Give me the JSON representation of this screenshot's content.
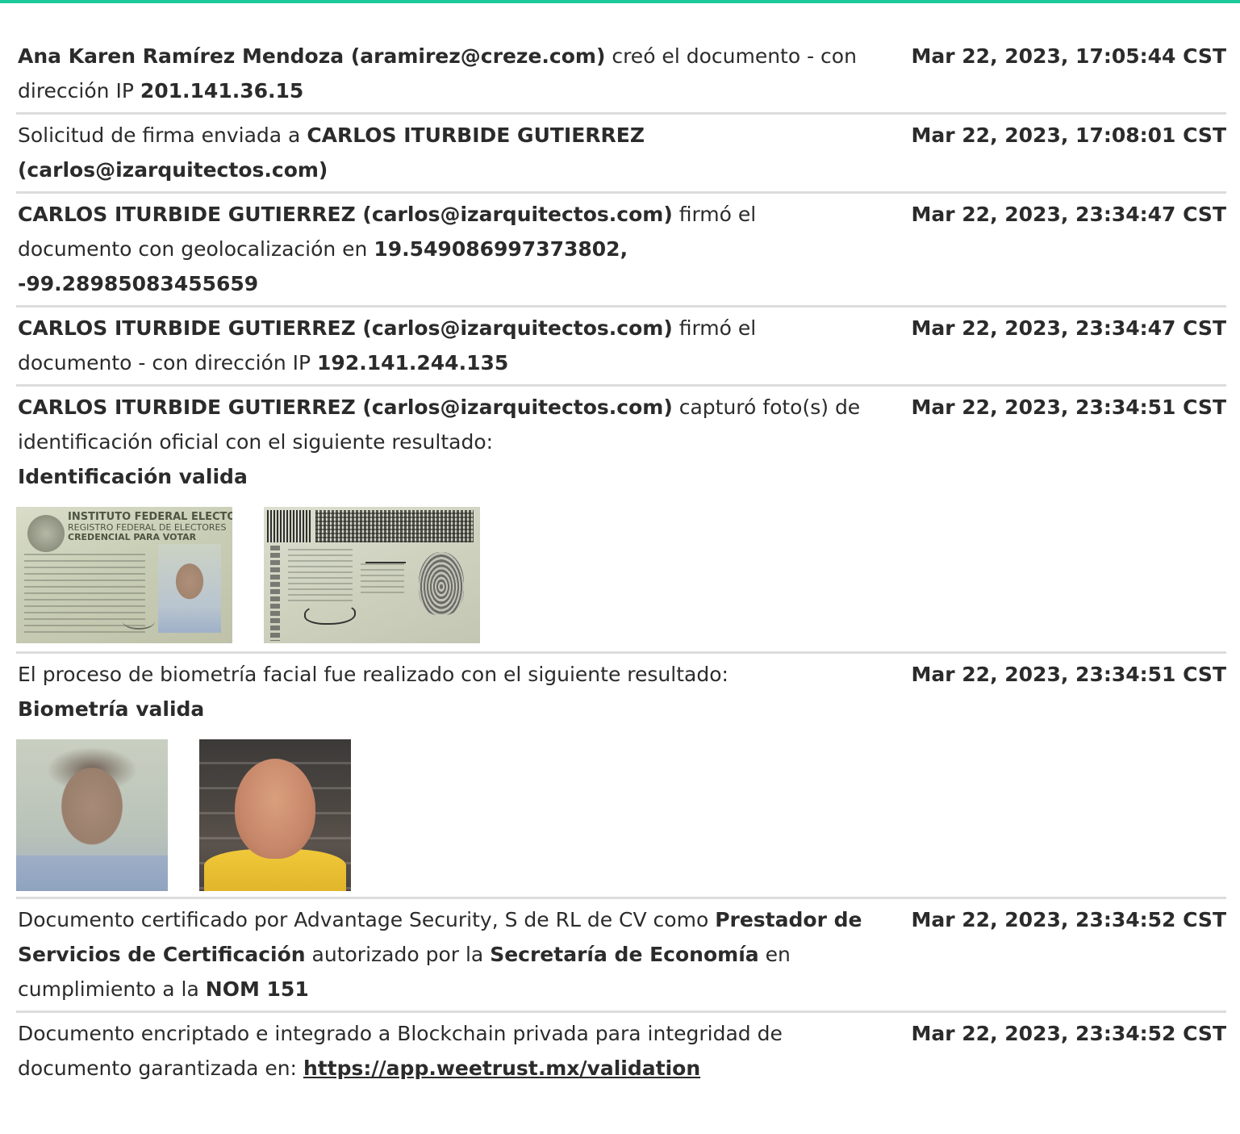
{
  "accent_color": "#1cc99b",
  "entries": [
    {
      "parts": [
        {
          "t": "Ana Karen Ramírez Mendoza (aramirez@creze.com)",
          "b": true
        },
        {
          "t": " creó el documento - con dirección IP ",
          "b": false
        },
        {
          "t": "201.141.36.15",
          "b": true
        }
      ],
      "timestamp": "Mar 22, 2023, 17:05:44 CST"
    },
    {
      "parts": [
        {
          "t": "Solicitud de firma enviada a ",
          "b": false
        },
        {
          "t": "CARLOS ITURBIDE GUTIERREZ (carlos@izarquitectos.com)",
          "b": true
        }
      ],
      "timestamp": "Mar 22, 2023, 17:08:01 CST"
    },
    {
      "parts": [
        {
          "t": "CARLOS ITURBIDE GUTIERREZ (carlos@izarquitectos.com)",
          "b": true
        },
        {
          "t": " firmó el documento con geolocalización en ",
          "b": false
        },
        {
          "t": "19.549086997373802, -99.28985083455659",
          "b": true
        }
      ],
      "timestamp": "Mar 22, 2023, 23:34:47 CST"
    },
    {
      "parts": [
        {
          "t": "CARLOS ITURBIDE GUTIERREZ (carlos@izarquitectos.com)",
          "b": true
        },
        {
          "t": " firmó el documento - con dirección IP ",
          "b": false
        },
        {
          "t": "192.141.244.135",
          "b": true
        }
      ],
      "timestamp": "Mar 22, 2023, 23:34:47 CST"
    },
    {
      "parts": [
        {
          "t": "CARLOS ITURBIDE GUTIERREZ (carlos@izarquitectos.com)",
          "b": true
        },
        {
          "t": " capturó foto(s) de identificación oficial con el siguiente resultado:",
          "b": false
        }
      ],
      "result": "Identificación valida",
      "timestamp": "Mar 22, 2023, 23:34:51 CST",
      "images": [
        {
          "name": "ine-front-photo",
          "lines": [
            "INSTITUTO FEDERAL ELECTORAL",
            "REGISTRO FEDERAL DE ELECTORES",
            "CREDENCIAL PARA VOTAR"
          ]
        },
        {
          "name": "ine-back-photo"
        }
      ]
    },
    {
      "parts": [
        {
          "t": "El proceso de biometría facial fue realizado con el siguiente resultado:",
          "b": false
        }
      ],
      "result": "Biometría valida",
      "timestamp": "Mar 22, 2023, 23:34:51 CST",
      "images": [
        {
          "name": "id-face-photo"
        },
        {
          "name": "live-face-photo"
        }
      ]
    },
    {
      "parts": [
        {
          "t": "Documento certificado por Advantage Security, S de RL de CV como ",
          "b": false
        },
        {
          "t": "Prestador de Servicios de Certificación",
          "b": true
        },
        {
          "t": " autorizado por la ",
          "b": false
        },
        {
          "t": "Secretaría de Economía",
          "b": true
        },
        {
          "t": " en cumplimiento a la ",
          "b": false
        },
        {
          "t": "NOM 151",
          "b": true
        }
      ],
      "timestamp": "Mar 22, 2023, 23:34:52 CST"
    },
    {
      "parts": [
        {
          "t": "Documento encriptado e integrado a Blockchain privada para integridad de documento garantizada en: ",
          "b": false
        },
        {
          "t": "https://app.weetrust.mx/validation",
          "b": true,
          "link": true
        }
      ],
      "timestamp": "Mar 22, 2023, 23:34:52 CST"
    }
  ]
}
